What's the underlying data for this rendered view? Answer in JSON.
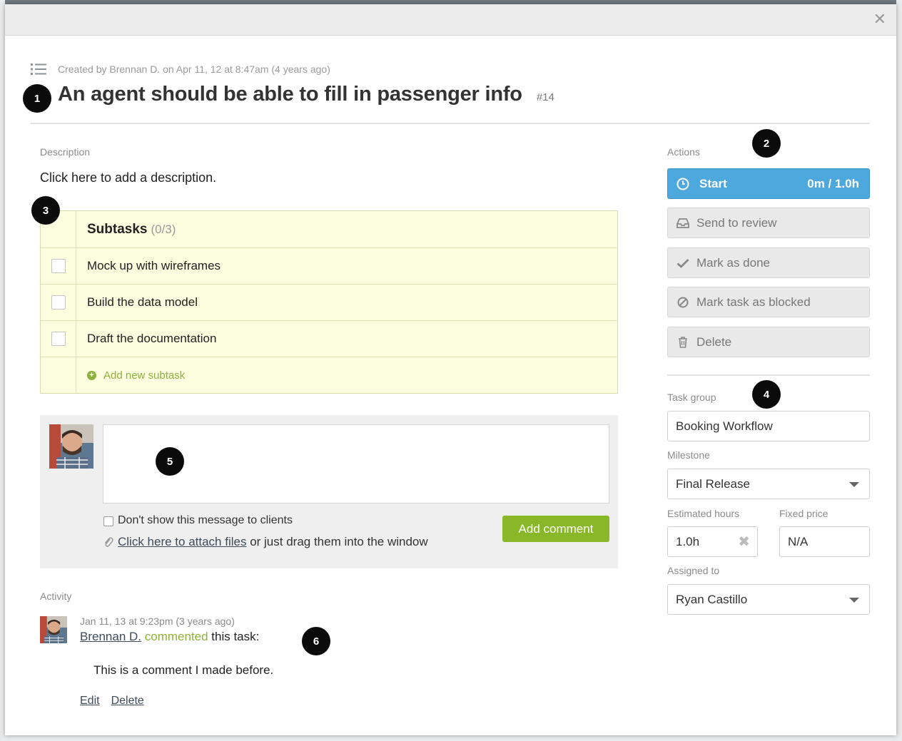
{
  "header": {
    "close_icon": "close-icon"
  },
  "task": {
    "created_text": "Created by Brennan D. on Apr 11, 12 at 8:47am (4 years ago)",
    "title": "An agent should be able to fill in passenger info",
    "number": "#14"
  },
  "badges": [
    "1",
    "2",
    "3",
    "4",
    "5",
    "6"
  ],
  "description": {
    "label": "Description",
    "placeholder_text": "Click here to add a description."
  },
  "subtasks": {
    "title": "Subtasks",
    "count": "(0/3)",
    "items": [
      {
        "label": "Mock up with wireframes",
        "checked": false
      },
      {
        "label": "Build the data model",
        "checked": false
      },
      {
        "label": "Draft the documentation",
        "checked": false
      }
    ],
    "add_label": "Add new subtask"
  },
  "comment": {
    "input_value": "",
    "dont_show_label": "Don't show this message to clients",
    "attach_link": "Click here to attach files",
    "attach_rest": " or just drag them into the window",
    "submit_label": "Add comment"
  },
  "activity": {
    "label": "Activity",
    "items": [
      {
        "time": "Jan 11, 13 at 9:23pm (3 years ago)",
        "user": "Brennan D.",
        "verb": "commented",
        "object": " this task:",
        "comment": "This is a comment I made before.",
        "edit_label": "Edit",
        "delete_label": "Delete"
      }
    ]
  },
  "actions": {
    "label": "Actions",
    "start_label": "Start",
    "start_time": "0m / 1.0h",
    "send_review_label": "Send to review",
    "mark_done_label": "Mark as done",
    "mark_blocked_label": "Mark task as blocked",
    "delete_label": "Delete"
  },
  "details": {
    "task_group_label": "Task group",
    "task_group_value": "Booking Workflow",
    "milestone_label": "Milestone",
    "milestone_value": "Final Release",
    "estimated_label": "Estimated hours",
    "estimated_value": "1.0h",
    "fixed_price_label": "Fixed price",
    "fixed_price_value": "N/A",
    "assigned_label": "Assigned to",
    "assigned_value": "Ryan Castillo"
  },
  "colors": {
    "accent_blue": "#4da8de",
    "accent_green": "#88b828",
    "subtask_bg": "#fdfde0"
  }
}
